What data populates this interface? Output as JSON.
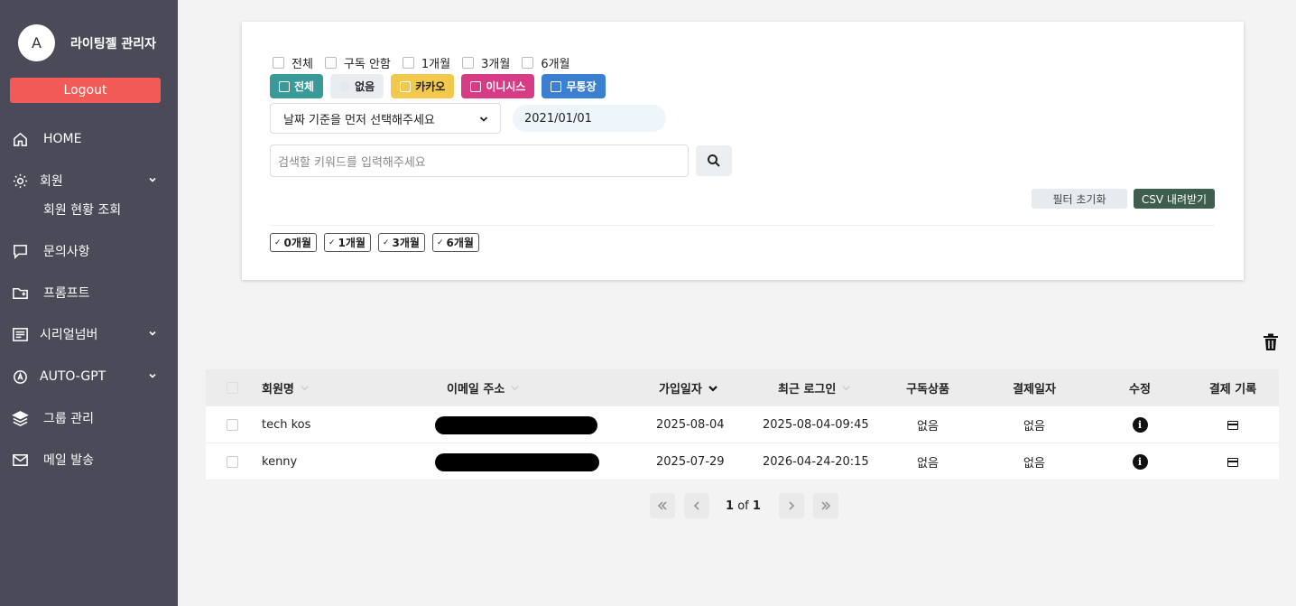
{
  "sidebar": {
    "avatar_letter": "A",
    "admin_name": "라이팅젤 관리자",
    "logout_label": "Logout",
    "items": [
      {
        "label": "HOME",
        "icon": "home-icon"
      },
      {
        "label": "회원",
        "icon": "gear-user-icon",
        "expandable": true
      },
      {
        "label": "회원 현황 조회",
        "sub": true
      },
      {
        "label": "문의사항",
        "icon": "message-icon"
      },
      {
        "label": "프롬프트",
        "icon": "folder-plus-icon"
      },
      {
        "label": "시리얼넘버",
        "icon": "list-icon",
        "expandable": true
      },
      {
        "label": "AUTO-GPT",
        "icon": "auto-icon",
        "expandable": true
      },
      {
        "label": "그룹 관리",
        "icon": "layers-icon"
      },
      {
        "label": "메일 발송",
        "icon": "mail-icon"
      }
    ]
  },
  "filters": {
    "subscription_options": [
      "전체",
      "구독 안함",
      "1개월",
      "3개월",
      "6개월"
    ],
    "payment_options": [
      {
        "label": "전체",
        "color": "#3a9a9a",
        "text_color": "#ffffff"
      },
      {
        "label": "없음",
        "color": "#e9edf1",
        "text_color": "#222222"
      },
      {
        "label": "카카오",
        "color": "#f2c94c",
        "text_color": "#222222"
      },
      {
        "label": "이니시스",
        "color": "#d63c86",
        "text_color": "#ffffff"
      },
      {
        "label": "무통장",
        "color": "#3b7fd0",
        "text_color": "#ffffff"
      }
    ],
    "date_select_placeholder": "날짜 기준을 먼저 선택해주세요",
    "date_value": "2021/01/01",
    "search_placeholder": "검색할 키워드를 입력해주세요",
    "reset_label": "필터 초기화",
    "csv_label": "CSV 내려받기",
    "active_tags": [
      "0개월",
      "1개월",
      "3개월",
      "6개월"
    ]
  },
  "table": {
    "columns": [
      "회원명",
      "이메일 주소",
      "가입일자",
      "최근 로그인",
      "구독상품",
      "결제일자",
      "수정",
      "결제 기록"
    ],
    "rows": [
      {
        "name": "tech kos",
        "email": "[redacted]",
        "joined": "2025-08-04",
        "last_login": "2025-08-04-09:45",
        "product": "없음",
        "payment_date": "없음"
      },
      {
        "name": "kenny",
        "email": "[redacted]",
        "joined": "2025-07-29",
        "last_login": "2026-04-24-20:15",
        "product": "없음",
        "payment_date": "없음"
      }
    ]
  },
  "pagination": {
    "current": "1",
    "of_label": "of",
    "total": "1"
  }
}
